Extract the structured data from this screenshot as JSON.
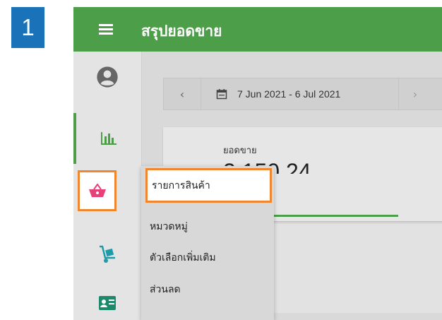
{
  "step": {
    "number": "1"
  },
  "app": {
    "title": "สรุปยอดขาย"
  },
  "sidebar": {
    "items": [
      {
        "name": "account",
        "icon": "account-circle-icon"
      },
      {
        "name": "reports",
        "icon": "bar-chart-icon",
        "active": true
      },
      {
        "name": "products",
        "icon": "shopping-basket-icon",
        "highlighted": true
      },
      {
        "name": "inventory",
        "icon": "hand-truck-icon"
      },
      {
        "name": "contacts",
        "icon": "id-card-icon"
      }
    ]
  },
  "date_filter": {
    "prev": "‹",
    "range": "7 Jun 2021 - 6 Jul 2021",
    "next": "›"
  },
  "sales_card": {
    "label": "ยอดขาย",
    "value": "3,150.24"
  },
  "dropdown": {
    "items": [
      {
        "label": "รายการสินค้า",
        "highlighted": true
      },
      {
        "label": "หมวดหมู่"
      },
      {
        "label": "ตัวเลือกเพิ่มเติม"
      },
      {
        "label": "ส่วนลด"
      }
    ]
  },
  "colors": {
    "topbar": "#4d9e49",
    "badge": "#1a73b8",
    "highlight": "#f0872f",
    "basket": "#e8417a",
    "cart": "#1f9aa8",
    "card_icon": "#1a8a6a"
  }
}
